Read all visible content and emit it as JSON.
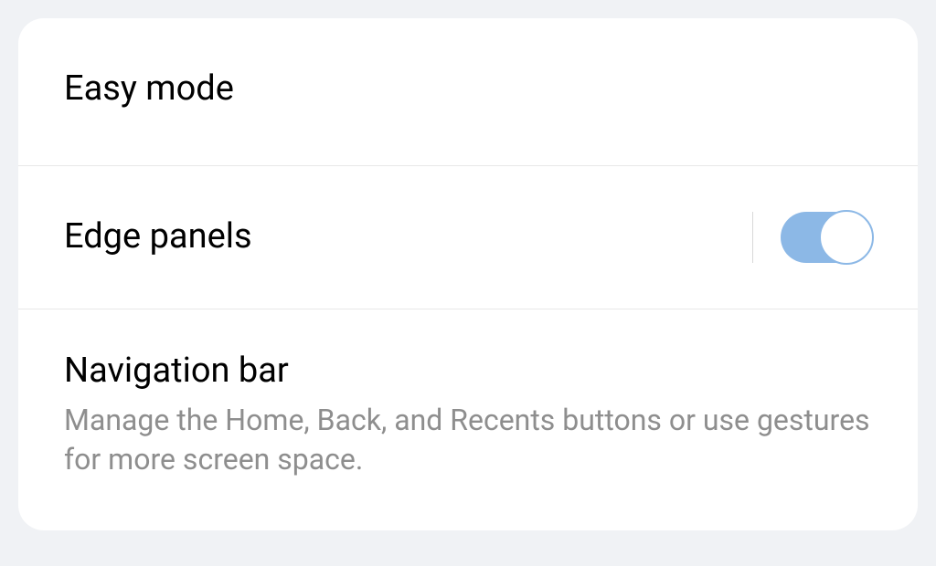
{
  "settings": {
    "easy_mode": {
      "title": "Easy mode"
    },
    "edge_panels": {
      "title": "Edge panels",
      "enabled": true
    },
    "navigation_bar": {
      "title": "Navigation bar",
      "description": "Manage the Home, Back, and Recents buttons or use gestures for more screen space."
    }
  }
}
